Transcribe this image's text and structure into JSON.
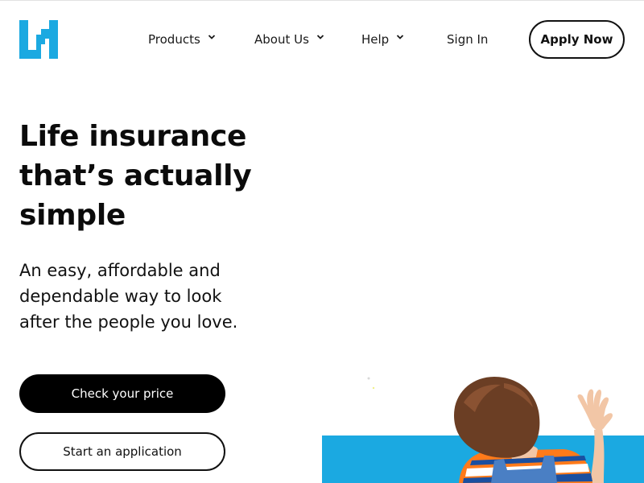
{
  "header": {
    "logo_icon": "lh-logo-icon",
    "brand_color": "#1ba9e1",
    "nav": [
      {
        "label": "Products",
        "icon": "chevron-down-icon"
      },
      {
        "label": "About Us",
        "icon": "chevron-down-icon"
      },
      {
        "label": "Help",
        "icon": "chevron-down-icon"
      }
    ],
    "sign_in_label": "Sign In",
    "apply_label": "Apply Now"
  },
  "hero": {
    "title_lines": [
      "Life insurance",
      "that’s actually",
      "simple"
    ],
    "subtitle_lines": [
      "An easy, affordable and",
      "dependable way to look",
      "after the people you love."
    ],
    "primary_cta": "Check your price",
    "secondary_cta": "Start an application",
    "image_accent_color": "#1ba9e1"
  }
}
